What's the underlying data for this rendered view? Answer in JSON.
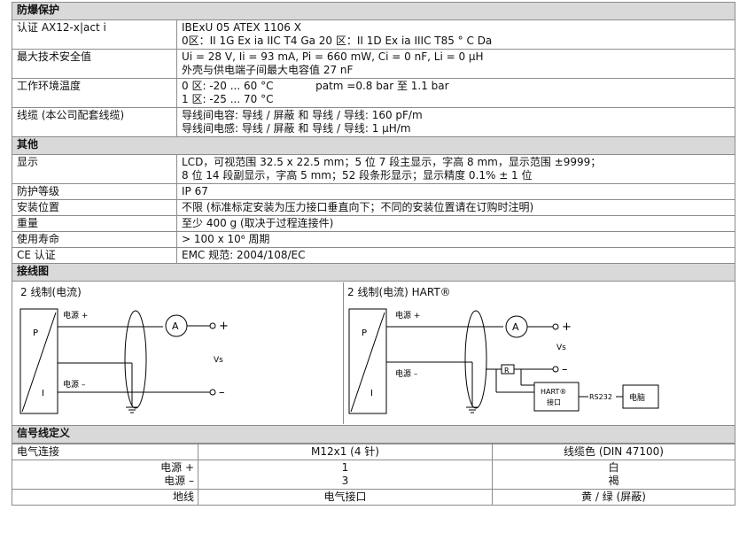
{
  "sections": {
    "explosion": "防爆保护",
    "other": "其他",
    "wiring": "接线图",
    "signal": "信号线定义"
  },
  "explosion": {
    "cert_label": "认证  AX12-x|act i",
    "cert_line1": "IBExU 05 ATEX 1106 X",
    "cert_line2": "0区：II 1G Ex ia IIC T4 Ga     20 区：II 1D Ex ia IIIC T85 ° C Da",
    "max_label": "最大技术安全值",
    "max_line1": "Ui = 28 V, Ii = 93 mA, Pi = 660 mW, Ci = 0 nF, Li = 0 µH",
    "max_line2": "外壳与供电端子间最大电容值 27 nF",
    "temp_label": "工作环境温度",
    "temp_line1": "0 区: -20 ... 60 °C",
    "temp_patm": "patm =0.8 bar  至  1.1 bar",
    "temp_line2": "1 区: -25 ... 70 °C",
    "cable_label": "线缆  (本公司配套线缆)",
    "cable_line1": "导线间电容:   导线  /  屏蔽  和  导线  /  导线: 160 pF/m",
    "cable_line2": "导线间电感:   导线  /  屏蔽  和  导线  /  导线: 1 µH/m"
  },
  "other": {
    "display_label": "显示",
    "display_line1": "LCD，可视范围  32.5 x 22.5 mm；5 位 7 段主显示，字高  8 mm，显示范围  ±9999；",
    "display_line2": "8 位 14 段副显示，字高  5 mm；52 段条形显示；显示精度  0.1% ± 1  位",
    "ip_label": "防护等级",
    "ip_value": "IP 67",
    "mount_label": "安装位置",
    "mount_value": "不限  (标准标定安装为压力接口垂直向下；不同的安装位置请在订购时注明)",
    "weight_label": "重量",
    "weight_value": "至少  400 g (取决于过程连接件)",
    "life_label": "使用寿命",
    "life_value": "> 100 x 10⁶  周期",
    "ce_label": "CE 认证",
    "ce_value": "EMC  规范: 2004/108/EC"
  },
  "wiring": {
    "left_title": "2 线制(电流)",
    "right_title": "2 线制(电流)    HART®",
    "p": "P",
    "i": "I",
    "pos": "电源  +",
    "neg": "电源  –",
    "a": "A",
    "plus": "+",
    "minus": "–",
    "vs": "Vs",
    "r": "R",
    "hart": "HART®",
    "port": "接口",
    "rs232": "RS232",
    "pc": "电脑"
  },
  "signal": {
    "headers": [
      "电气连接",
      "M12x1 (4 针)",
      "线缆色  (DIN 47100)"
    ],
    "row1_label_a": "电源  +",
    "row1_label_b": "电源  –",
    "row1_pin_a": "1",
    "row1_pin_b": "3",
    "row1_col_a": "白",
    "row1_col_b": "褐",
    "row2_label": "地线",
    "row2_pin": "电气接口",
    "row2_col": "黄  /  绿  (屏蔽)"
  }
}
